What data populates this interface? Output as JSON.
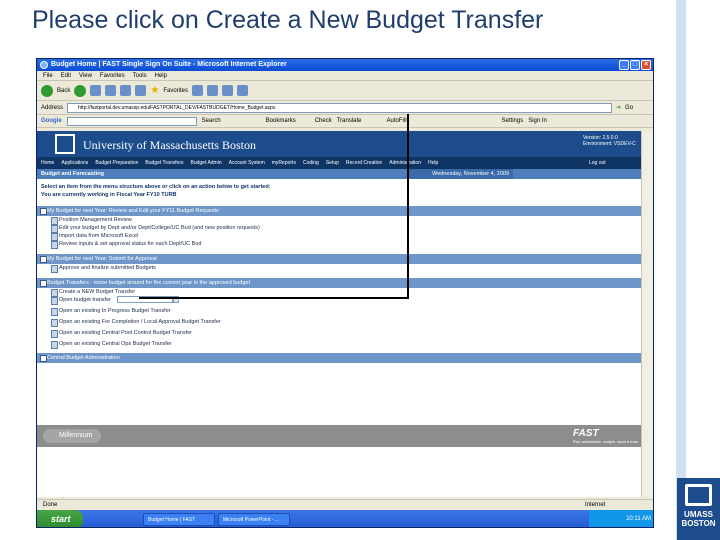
{
  "slide": {
    "title": "Please click on Create a New Budget Transfer",
    "logo_text": "UMASS BOSTON"
  },
  "browser": {
    "window_title": "Budget Home | FAST Single Sign On Suite - Microsoft Internet Explorer",
    "menu": [
      "File",
      "Edit",
      "View",
      "Favorites",
      "Tools",
      "Help"
    ],
    "toolbar": {
      "back": "Back",
      "favorites": "Favorites"
    },
    "address_label": "Address",
    "address": "http://fastportal.dev.umassp.edu/FASTPORTAL_DEV/FASTBUDGET/Home_Budget.aspx",
    "go_label": "Go",
    "google": {
      "logo": "Google",
      "search": "Search",
      "bookmarks": "Bookmarks",
      "check": "Check",
      "translate": "Translate",
      "autofill": "AutoFill",
      "settings": "Settings",
      "signin": "Sign In"
    },
    "status": "Done",
    "zone": "Internet",
    "taskbar": {
      "start": "start",
      "tasks": [
        "Budget Home | FAST Single...",
        "Microsoft PowerPoint - ..."
      ],
      "clock": "10:11 AM"
    }
  },
  "app": {
    "university": "University of Massachusetts Boston",
    "version": "Version: 2.5.0.0",
    "environment": "Environment: VSDEV-C",
    "nav": [
      "Home",
      "Applications",
      "Budget Preparation",
      "Budget Transfers",
      "Budget Admin",
      "Account System",
      "myReports",
      "Coding",
      "Setup",
      "Record Creation",
      "Administration",
      "Help"
    ],
    "logout": "Log out",
    "section_title": "Budget and Forecasting",
    "date": "Wednesday, November 4, 2009",
    "intro_line1": "Select an item from the menu structure above or click on an action below to get started:",
    "intro_line2": "You are currently working in Fiscal Year FY10 TURB",
    "groups": [
      {
        "title": "My Budget for next Year: Review and Edit your FY11 Budget Requests",
        "items": [
          "Position Management Review",
          "Edit your budget by Dept and/or Dept/College/UC Bud (and new position requests)",
          "Import data from Microsoft Excel",
          "Review inputs & set approval status for each Dept/UC Bud"
        ]
      },
      {
        "title": "My Budget for next Year: Submit for Approval",
        "items": [
          "Approve and finalize submitted Budgets"
        ]
      },
      {
        "title": "Budget Transfers - move budget around for the current year in the approved budget",
        "items": [
          "Create a NEW Budget Transfer",
          "Open budget transfer",
          "Open an existing In Progress Budget Transfer",
          "Open an existing For Completion / Local Approval Budget Transfer",
          "Open an existing Central Pool Control Budget Transfer",
          "Open an existing Central Ops Budget Transfer"
        ]
      },
      {
        "title": "Central Budget Administration",
        "items": []
      }
    ],
    "footer_logo": "Millennium",
    "footer_brand": "FAST",
    "footer_tagline": "Plan, administrate, analyze, report & track"
  }
}
